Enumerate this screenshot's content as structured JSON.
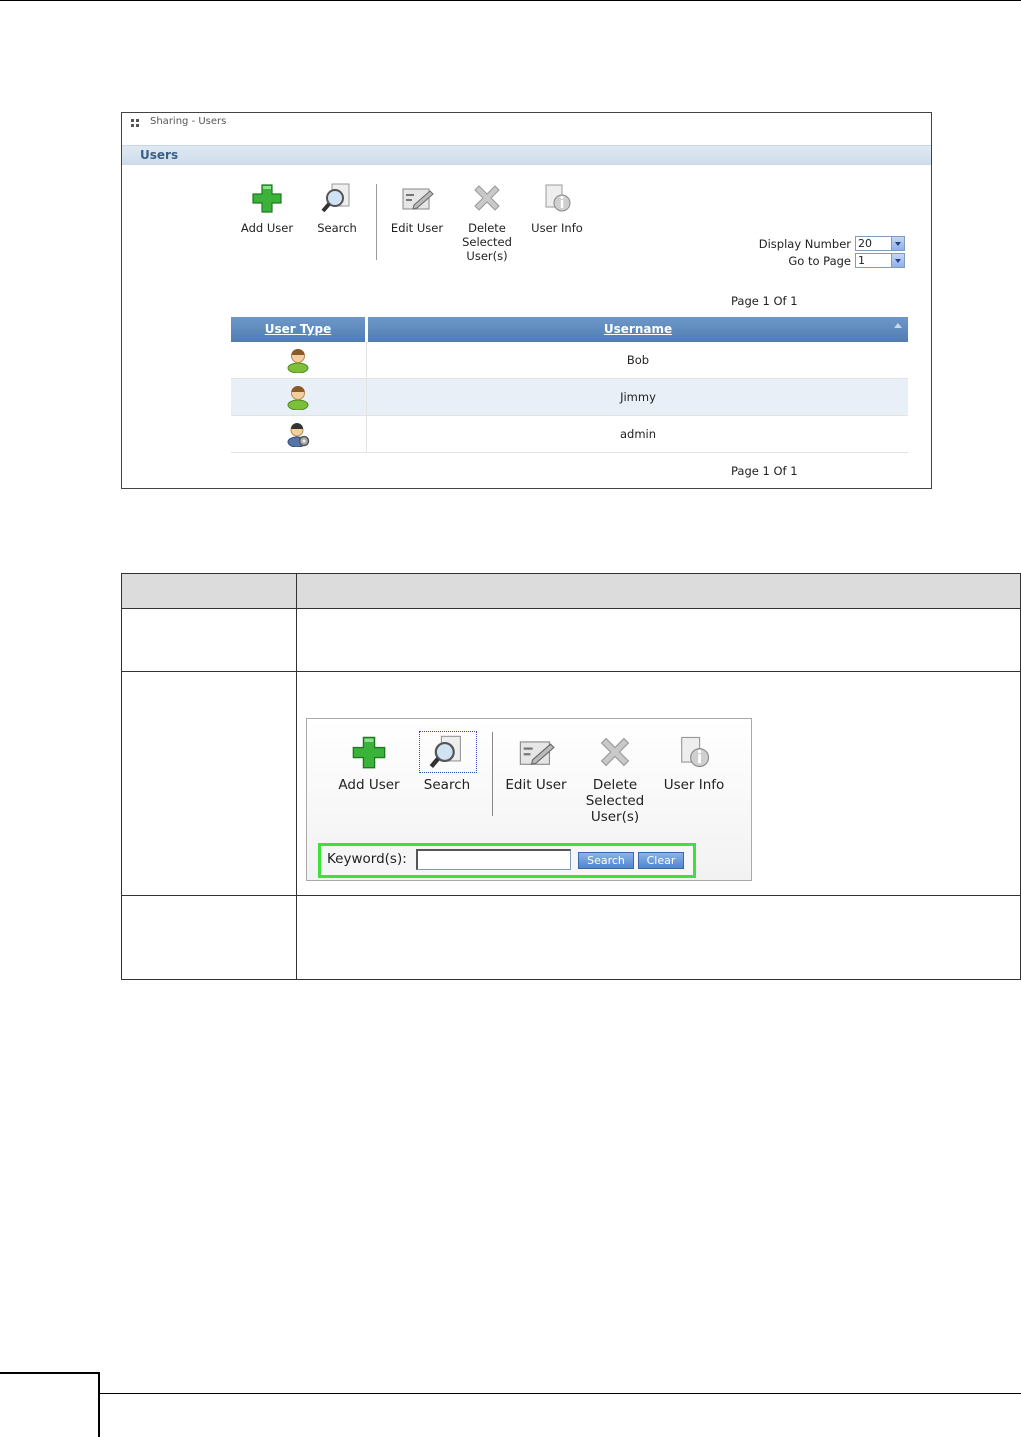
{
  "panel": {
    "breadcrumb": "Sharing - Users",
    "section_title": "Users",
    "toolbar": {
      "add_user": "Add User",
      "search": "Search",
      "edit_user": "Edit User",
      "delete_line1": "Delete",
      "delete_line2": "Selected",
      "delete_line3": "User(s)",
      "user_info": "User Info"
    },
    "display_number_label": "Display Number",
    "display_number_value": "20",
    "go_to_page_label": "Go to Page",
    "go_to_page_value": "1",
    "page_info_top": "Page 1 Of 1",
    "page_info_bottom": "Page 1 Of 1",
    "table": {
      "col_user_type": "User Type",
      "col_username": "Username",
      "rows": [
        {
          "username": "Bob",
          "type": "user"
        },
        {
          "username": "Jimmy",
          "type": "user"
        },
        {
          "username": "admin",
          "type": "admin"
        }
      ]
    }
  },
  "inset": {
    "toolbar": {
      "add_user": "Add User",
      "search": "Search",
      "edit_user": "Edit User",
      "delete_line1": "Delete",
      "delete_line2": "Selected",
      "delete_line3": "User(s)",
      "user_info": "User Info"
    },
    "keyword_label": "Keyword(s):",
    "keyword_value": "",
    "search_button": "Search",
    "clear_button": "Clear"
  },
  "colors": {
    "accent_blue": "#4f7db3",
    "highlight_green": "#3ce23c",
    "add_green": "#3bb33b"
  }
}
